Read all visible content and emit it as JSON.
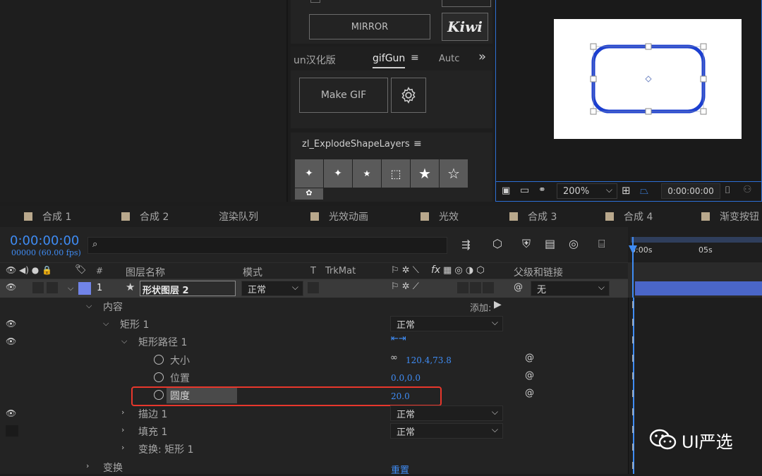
{
  "effects_panel": {
    "mirror_label": "MIRROR",
    "kiwi_label": "Kiwi",
    "tabs": [
      "un汉化版",
      "gifGun",
      "Autc"
    ],
    "more_label": "»",
    "make_gif_label": "Make GIF",
    "explode_title": "zl_ExplodeShapeLayers"
  },
  "viewer": {
    "zoom": "200%",
    "timecode": "0:00:00:00"
  },
  "comp_tabs": [
    "合成 1",
    "合成 2",
    "渲染队列",
    "光效动画",
    "光效",
    "合成 3",
    "合成 4",
    "渐变按钮"
  ],
  "timeline": {
    "current_time": "0:00:00:00",
    "frame_info": "00000 (60.00 fps)",
    "ruler": [
      "0:00s",
      "05s"
    ],
    "columns": {
      "hash": "#",
      "layer_name": "图层名称",
      "mode": "模式",
      "t": "T",
      "trkmat": "TrkMat",
      "fx": "fx",
      "parent": "父级和链接"
    },
    "layer": {
      "number": "1",
      "name": "形状图层 2",
      "mode": "正常",
      "parent": "无"
    },
    "props": {
      "contents": "内容",
      "add": "添加:",
      "rect1": "矩形 1",
      "rect1_mode": "正常",
      "rect_path": "矩形路径 1",
      "size": "大小",
      "size_value": "120.4,73.8",
      "position": "位置",
      "position_value": "0.0,0.0",
      "roundness": "圆度",
      "roundness_value": "20.0",
      "stroke": "描边 1",
      "stroke_mode": "正常",
      "fill": "填充 1",
      "fill_mode": "正常",
      "transform_rect": "变换: 矩形 1",
      "transform": "变换",
      "reset": "重置"
    }
  },
  "watermark": "UI严选",
  "colors": {
    "accent_blue": "#3f8cf4",
    "highlight_red": "#e8372c",
    "shape_stroke": "#1c3fd0",
    "layer_label": "#7184e8"
  }
}
